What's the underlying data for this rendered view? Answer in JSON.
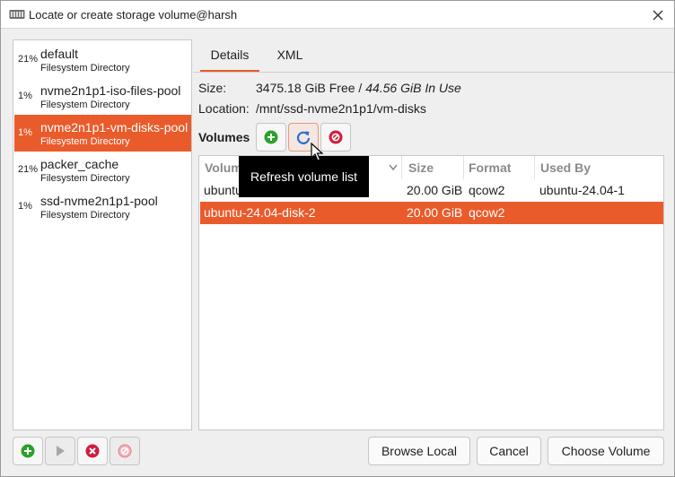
{
  "window": {
    "title": "Locate or create storage volume@harsh"
  },
  "pools": [
    {
      "percent": "21%",
      "name": "default",
      "type": "Filesystem Directory"
    },
    {
      "percent": "1%",
      "name": "nvme2n1p1-iso-files-pool",
      "type": "Filesystem Directory"
    },
    {
      "percent": "1%",
      "name": "nvme2n1p1-vm-disks-pool",
      "type": "Filesystem Directory",
      "selected": true
    },
    {
      "percent": "21%",
      "name": "packer_cache",
      "type": "Filesystem Directory"
    },
    {
      "percent": "1%",
      "name": "ssd-nvme2n1p1-pool",
      "type": "Filesystem Directory"
    }
  ],
  "tabs": {
    "details": "Details",
    "xml": "XML"
  },
  "details": {
    "size_label": "Size:",
    "size_free": "3475.18 GiB Free / ",
    "size_in_use": "44.56 GiB In Use",
    "location_label": "Location:",
    "location_value": "/mnt/ssd-nvme2n1p1/vm-disks",
    "volumes_label": "Volumes"
  },
  "table": {
    "headers": {
      "volumes": "Volum",
      "size": "Size",
      "format": "Format",
      "used_by": "Used By"
    },
    "rows": [
      {
        "name": "ubuntu",
        "size": "20.00 GiB",
        "format": "qcow2",
        "used_by": "ubuntu-24.04-1"
      },
      {
        "name": "ubuntu-24.04-disk-2",
        "size": "20.00 GiB",
        "format": "qcow2",
        "used_by": "",
        "selected": true
      }
    ]
  },
  "tooltip": "Refresh volume list",
  "buttons": {
    "browse_local": "Browse Local",
    "cancel": "Cancel",
    "choose_volume": "Choose Volume"
  },
  "icons": {
    "add": "add-icon",
    "refresh": "refresh-icon",
    "delete": "delete-icon",
    "start": "play-icon",
    "stop": "stop-icon"
  },
  "colors": {
    "accent": "#ea5b2b",
    "add_green": "#2ca02c",
    "delete_red": "#d01d3c"
  }
}
